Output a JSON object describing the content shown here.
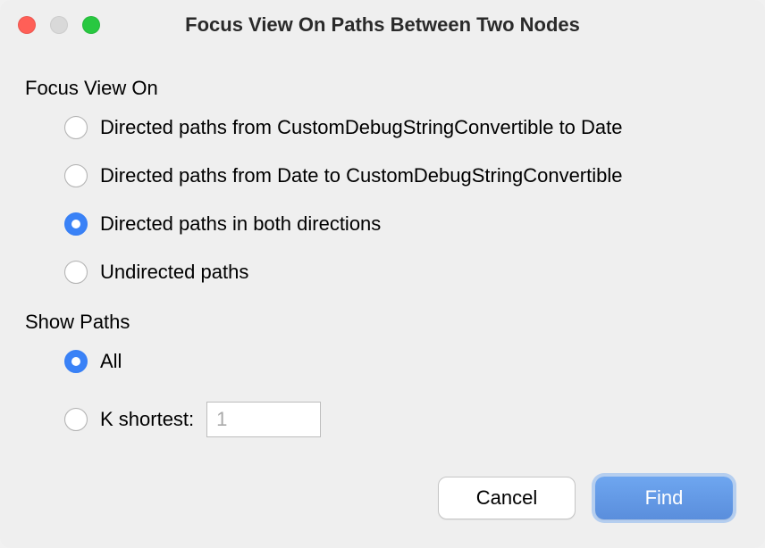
{
  "titlebar": {
    "title": "Focus View On Paths Between Two Nodes"
  },
  "sections": {
    "focusView": {
      "label": "Focus View On",
      "options": [
        {
          "label": "Directed paths from CustomDebugStringConvertible to Date",
          "selected": false
        },
        {
          "label": "Directed paths from Date to CustomDebugStringConvertible",
          "selected": false
        },
        {
          "label": "Directed paths in both directions",
          "selected": true
        },
        {
          "label": "Undirected paths",
          "selected": false
        }
      ]
    },
    "showPaths": {
      "label": "Show Paths",
      "options": {
        "all": {
          "label": "All",
          "selected": true
        },
        "kshortest": {
          "label": "K shortest:",
          "selected": false,
          "value": "1"
        }
      }
    }
  },
  "buttons": {
    "cancel": "Cancel",
    "find": "Find"
  }
}
